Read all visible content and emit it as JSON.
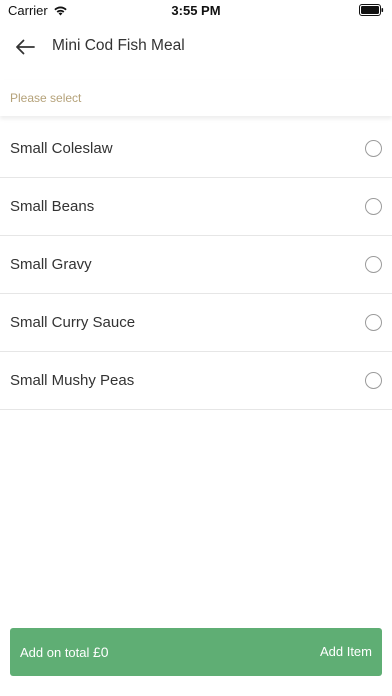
{
  "status_bar": {
    "carrier": "Carrier",
    "time": "3:55 PM"
  },
  "header": {
    "title": "Mini Cod Fish Meal"
  },
  "selection": {
    "prompt": "Please select",
    "options": [
      {
        "label": "Small Coleslaw",
        "selected": false
      },
      {
        "label": "Small Beans",
        "selected": false
      },
      {
        "label": "Small Gravy",
        "selected": false
      },
      {
        "label": "Small Curry Sauce",
        "selected": false
      },
      {
        "label": "Small Mushy Peas",
        "selected": false
      }
    ]
  },
  "footer": {
    "total_prefix": "Add on total",
    "total_amount": "£0",
    "add_label": "Add Item"
  },
  "colors": {
    "accent_green": "#5fae74",
    "prompt_tan": "#b5a27a"
  },
  "icons": {
    "back": "arrow-left-icon",
    "wifi": "wifi-icon",
    "battery": "battery-icon"
  }
}
